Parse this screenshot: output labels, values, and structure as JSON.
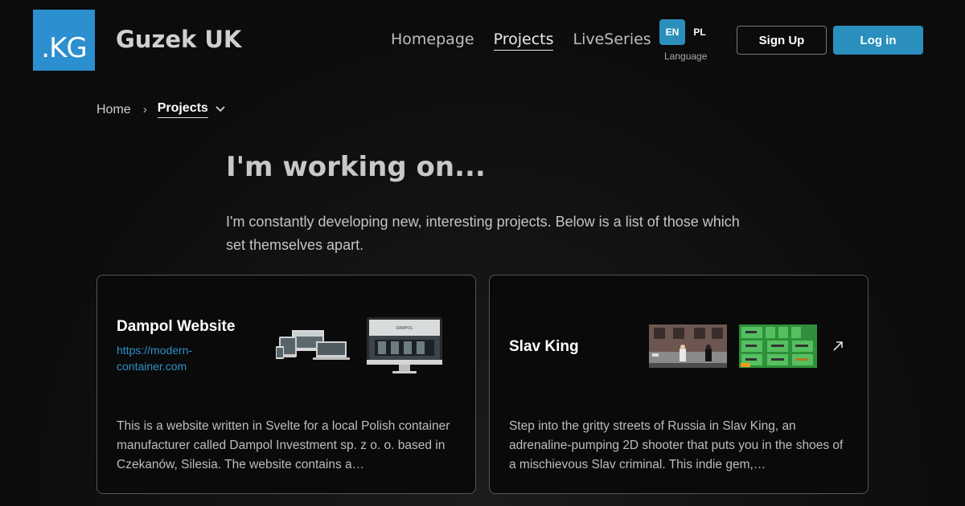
{
  "header": {
    "logo_text": ".KG",
    "site_name": "Guzek UK",
    "nav": [
      {
        "label": "Homepage"
      },
      {
        "label": "Projects"
      },
      {
        "label": "LiveSeries"
      }
    ],
    "language": {
      "en": "EN",
      "pl": "PL",
      "label": "Language"
    },
    "signup_label": "Sign Up",
    "login_label": "Log in",
    "accent_color": "#2b8fbd"
  },
  "breadcrumb": {
    "home": "Home",
    "separator": "›",
    "current": "Projects"
  },
  "hero": {
    "title": "I'm working on...",
    "description": "I'm constantly developing new, interesting projects. Below is a list of those which set themselves apart."
  },
  "projects": [
    {
      "title": "Dampol Website",
      "link": "https://modern-container.com",
      "description": "This is a website written in Svelte for a local Polish container manufacturer called Dampol Investment sp. z o. o. based in Czekanów, Silesia. The website contains a…",
      "screen_text": "DAMPOL"
    },
    {
      "title": "Slav King",
      "description": "Step into the gritty streets of Russia in Slav King, an adrenaline-pumping 2D shooter that puts you in the shoes of a mischievous Slav criminal. This indie gem,…"
    }
  ]
}
